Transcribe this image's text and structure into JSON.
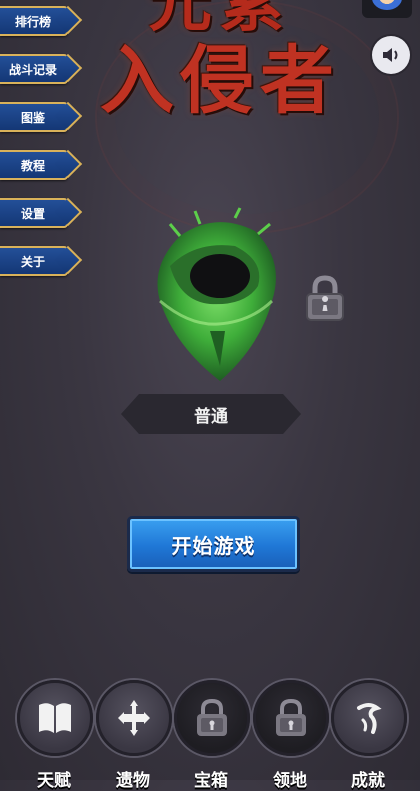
{
  "title": {
    "line1": "元素",
    "line2": "入侵者"
  },
  "menu": [
    {
      "label": "排行榜"
    },
    {
      "label": "战斗记录"
    },
    {
      "label": "图鉴"
    },
    {
      "label": "教程"
    },
    {
      "label": "设置"
    },
    {
      "label": "关于"
    }
  ],
  "difficulty": {
    "label": "普通"
  },
  "start_button": {
    "label": "开始游戏"
  },
  "bottom_nav": [
    {
      "label": "天赋",
      "icon": "book-icon",
      "locked": false
    },
    {
      "label": "遗物",
      "icon": "cross-relic-icon",
      "locked": false
    },
    {
      "label": "宝箱",
      "icon": "lock-icon",
      "locked": true
    },
    {
      "label": "领地",
      "icon": "lock-icon",
      "locked": true
    },
    {
      "label": "成就",
      "icon": "achievement-icon",
      "locked": false
    }
  ],
  "colors": {
    "title_red": "#b52b1c",
    "menu_blue": "#234f98",
    "menu_border_gold": "#d9b25a",
    "start_blue": "#1f77d6",
    "portal_green": "#3fae3a"
  }
}
